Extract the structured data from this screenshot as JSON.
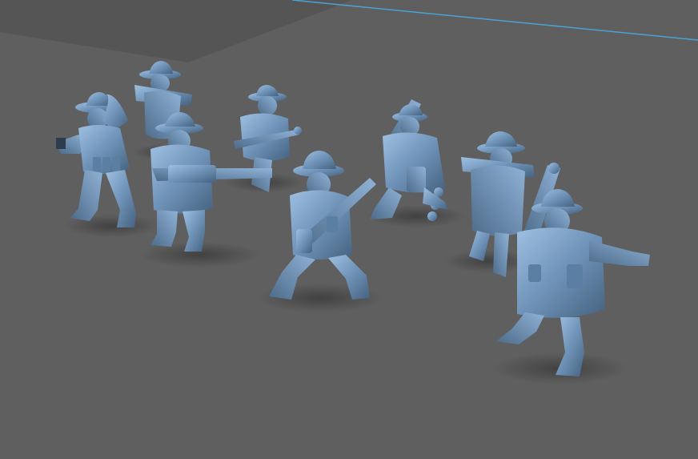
{
  "scene": {
    "background_color": "#5e5e5e",
    "floor_color": "#5f5f5f",
    "back_wall_color": "#545454",
    "grid_line_color": "#4aa3d6",
    "model_color": "#6f93b8",
    "model_shadow_color": "#4a4a4a",
    "figure_count": 8
  }
}
